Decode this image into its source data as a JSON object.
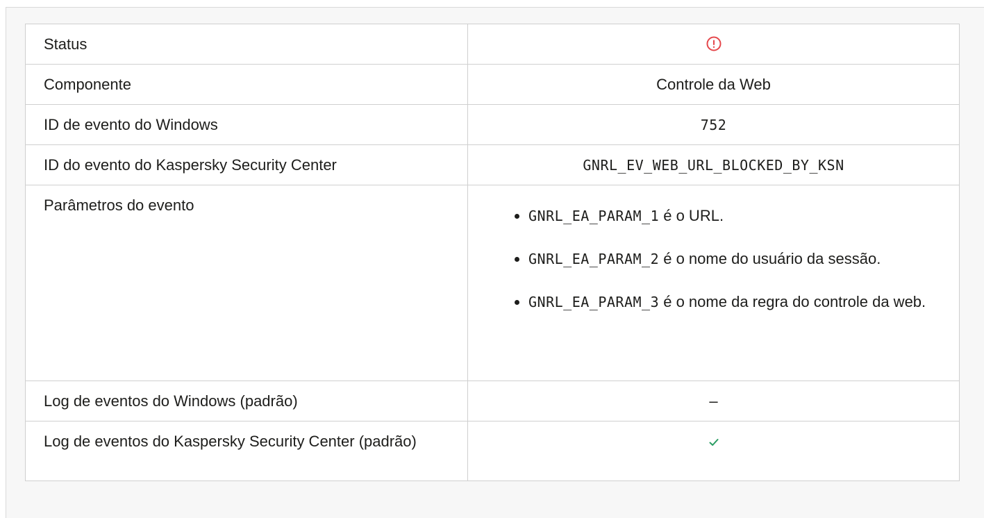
{
  "colors": {
    "status_icon": "#e5474b",
    "check_icon": "#2a9d63",
    "border": "#cfcfcf",
    "text": "#1d1d1b"
  },
  "rows": {
    "status": {
      "label": "Status",
      "value_icon": "exclamation-circle-icon"
    },
    "component": {
      "label": "Componente",
      "value": "Controle da Web"
    },
    "windows_event_id": {
      "label": "ID de evento do Windows",
      "value": "752"
    },
    "ksc_event_id": {
      "label": "ID do evento do Kaspersky Security Center",
      "value": "GNRL_EV_WEB_URL_BLOCKED_BY_KSN"
    },
    "event_params": {
      "label": "Parâmetros do evento",
      "items": [
        {
          "code": "GNRL_EA_PARAM_1",
          "text": " é o URL."
        },
        {
          "code": "GNRL_EA_PARAM_2",
          "text": " é o nome do usuário da sessão."
        },
        {
          "code": "GNRL_EA_PARAM_3",
          "text": " é o nome da regra do controle da web."
        }
      ]
    },
    "windows_log": {
      "label": "Log de eventos do Windows (padrão)",
      "value": "–"
    },
    "ksc_log": {
      "label": "Log de eventos do Kaspersky Security Center (padrão)",
      "value_icon": "checkmark-icon"
    }
  }
}
